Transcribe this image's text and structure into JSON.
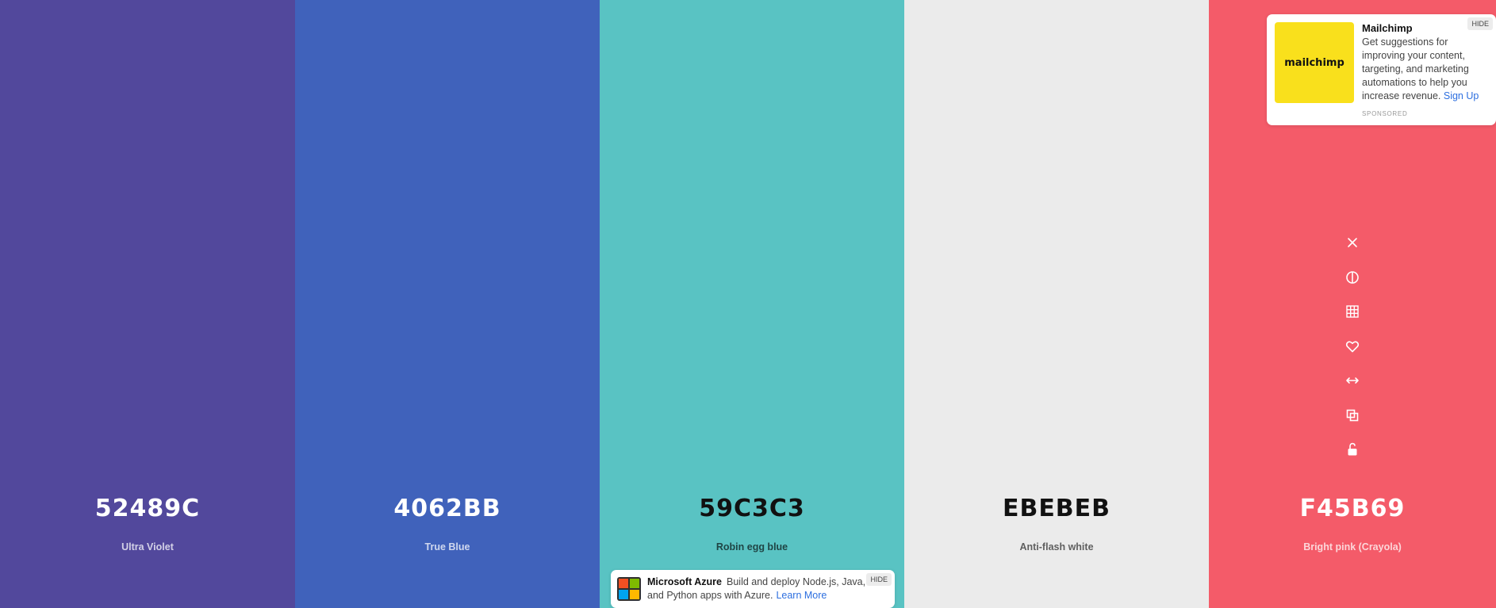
{
  "swatches": [
    {
      "hex": "52489C",
      "name": "Ultra Violet",
      "bg": "#52489C",
      "hex_color": "#FFFFFF",
      "name_color": "rgba(255,255,255,0.75)"
    },
    {
      "hex": "4062BB",
      "name": "True Blue",
      "bg": "#4062BB",
      "hex_color": "#FFFFFF",
      "name_color": "rgba(255,255,255,0.75)"
    },
    {
      "hex": "59C3C3",
      "name": "Robin egg blue",
      "bg": "#59C3C3",
      "hex_color": "#111111",
      "name_color": "rgba(0,0,0,0.65)"
    },
    {
      "hex": "EBEBEB",
      "name": "Anti-flash white",
      "bg": "#EBEBEB",
      "hex_color": "#111111",
      "name_color": "rgba(0,0,0,0.6)"
    },
    {
      "hex": "F45B69",
      "name": "Bright pink (Crayola)",
      "bg": "#F45B69",
      "hex_color": "#FFFFFF",
      "name_color": "rgba(255,255,255,0.75)"
    }
  ],
  "tools": [
    {
      "icon": "close-icon",
      "label": "Remove color"
    },
    {
      "icon": "contrast-icon",
      "label": "View shades"
    },
    {
      "icon": "grid-icon",
      "label": "View shades grid"
    },
    {
      "icon": "heart-icon",
      "label": "Save color"
    },
    {
      "icon": "drag-icon",
      "label": "Drag"
    },
    {
      "icon": "copy-icon",
      "label": "Copy hex"
    },
    {
      "icon": "lock-icon",
      "label": "Toggle lock"
    }
  ],
  "ad_top": {
    "title": "Mailchimp",
    "body": "Get suggestions for improving your content, targeting, and marketing automations to help you increase revenue.",
    "cta": "Sign Up",
    "sponsored": "SPONSORED",
    "hide": "HIDE",
    "logo_text": "mailchimp"
  },
  "ad_bottom": {
    "title": "Microsoft Azure",
    "body": "Build and deploy Node.js, Java, and Python apps with Azure.",
    "cta": "Learn More",
    "hide": "HIDE",
    "logo_colors": [
      "#F25022",
      "#7FBA00",
      "#00A4EF",
      "#FFB900"
    ]
  }
}
